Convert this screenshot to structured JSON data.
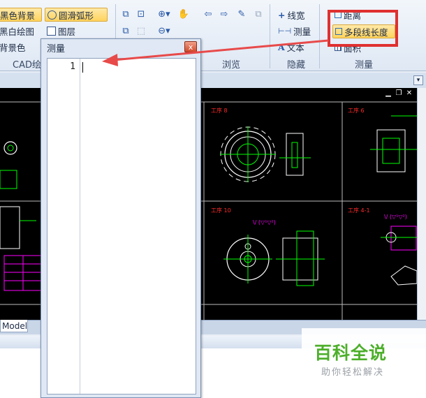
{
  "ribbon": {
    "buttons": {
      "black_bg": "黑色背景",
      "round_arc": "圆滑弧形",
      "bw_draw": "黑白绘图",
      "layer": "图层",
      "bg_color": "背景色",
      "line_width": "线宽",
      "measure": "测量",
      "text": "文本",
      "distance": "距离",
      "polyline_length": "多段线长度",
      "area": "面积"
    },
    "groups": {
      "cad_draw": "CAD绘",
      "browse": "浏览",
      "hide": "隐藏",
      "measure": "测量"
    }
  },
  "drawing": {
    "sheets": [
      {
        "label": "工序 8"
      },
      {
        "label": "工序 6"
      },
      {
        "label": "工序 10"
      },
      {
        "label": "工序 4-1"
      }
    ],
    "roughness_marks": [
      "\\/ (▽¹▽²)",
      "\\/ (▽¹▽²)"
    ]
  },
  "tabs": {
    "model": "Model"
  },
  "dialog": {
    "title": "测量",
    "close": "x",
    "line_number": "1"
  },
  "watermark": {
    "title": "百科全说",
    "subtitle": "助你轻松解决"
  },
  "colors": {
    "highlight_box": "#e03030",
    "arrow": "#e84a4a"
  }
}
